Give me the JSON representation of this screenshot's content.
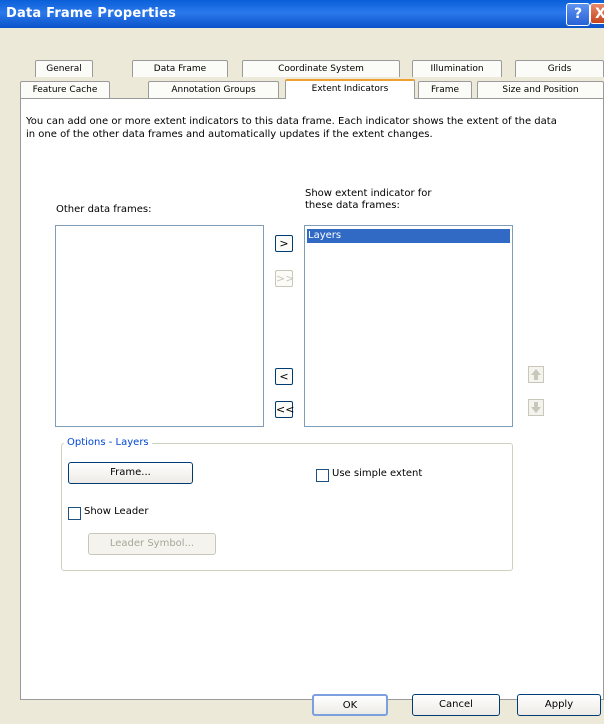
{
  "window": {
    "title": "Data Frame Properties",
    "help_glyph": "?",
    "close_glyph": "X"
  },
  "tabs": {
    "row1": [
      "General",
      "Data Frame",
      "Coordinate System",
      "Illumination",
      "Grids"
    ],
    "row2": [
      "Feature Cache",
      "Annotation Groups",
      "Extent Indicators",
      "Frame",
      "Size and Position"
    ],
    "active": "Extent Indicators"
  },
  "description": "You can add one or more extent indicators to this data frame.  Each indicator shows the extent of the data in one of the other data frames and automatically updates if the extent changes.",
  "other_frames": {
    "label": "Other data frames:",
    "items": []
  },
  "show_frames": {
    "label_line1": "Show extent indicator for",
    "label_line2": "these data frames:",
    "items": [
      "Layers"
    ]
  },
  "transfer_buttons": {
    "add": ">",
    "add_all": ">>",
    "remove": "<",
    "remove_all": "<<"
  },
  "options": {
    "group_label": "Options - Layers",
    "frame_button": "Frame...",
    "use_simple_extent": "Use simple extent",
    "use_simple_extent_checked": false,
    "show_leader": "Show Leader",
    "show_leader_checked": false,
    "leader_symbol_button": "Leader Symbol..."
  },
  "footer": {
    "ok": "OK",
    "cancel": "Cancel",
    "apply": "Apply"
  },
  "colors": {
    "title_bar": "#0a5fd8",
    "selection": "#316ac5",
    "group_label": "#0046d5",
    "dialog_bg": "#ece9d8"
  }
}
